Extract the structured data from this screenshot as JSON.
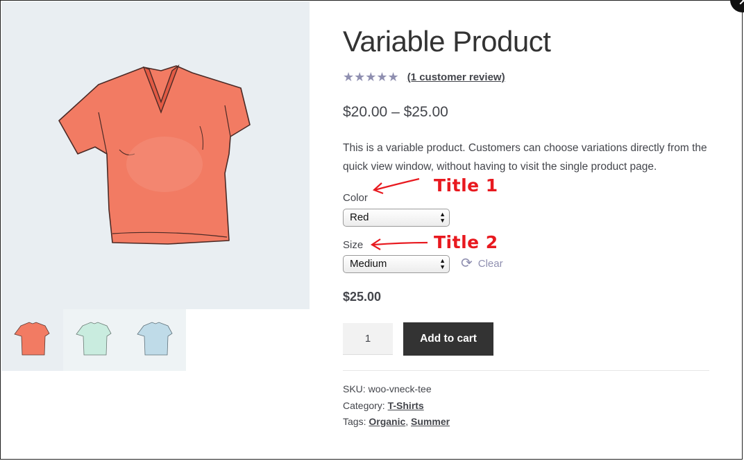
{
  "product": {
    "title": "Variable Product",
    "rating_stars": "★★★★★",
    "review_link": "(1 customer review)",
    "price_range": "$20.00 – $25.00",
    "description": "This is a variable product. Customers can choose variations directly from the quick view window, without having to visit the single product page."
  },
  "variations": {
    "color_label": "Color",
    "color_selected": "Red",
    "size_label": "Size",
    "size_selected": "Medium",
    "clear_label": "Clear"
  },
  "variation_price": "$25.00",
  "cart": {
    "quantity": "1",
    "add_to_cart_label": "Add to cart"
  },
  "meta": {
    "sku_label": "SKU:",
    "sku_value": "woo-vneck-tee",
    "category_label": "Category:",
    "category_value": "T-Shirts",
    "tags_label": "Tags:",
    "tag_1": "Organic",
    "tag_separator": ",",
    "tag_2": "Summer"
  },
  "annotations": {
    "title_1": "Title 1",
    "title_2": "Title 2"
  },
  "gallery": {
    "main_color": "#f27b63",
    "thumbnail_colors": [
      "#f27b63",
      "#c9ecdf",
      "#bfdbe8"
    ]
  },
  "icons": {
    "close": "close-icon",
    "refresh": "refresh-icon",
    "caret": "select-caret-icon"
  },
  "colors": {
    "star": "#8f8fb0",
    "button_bg": "#333333",
    "annotation": "#e8191f",
    "image_bg": "#e9eef2"
  }
}
